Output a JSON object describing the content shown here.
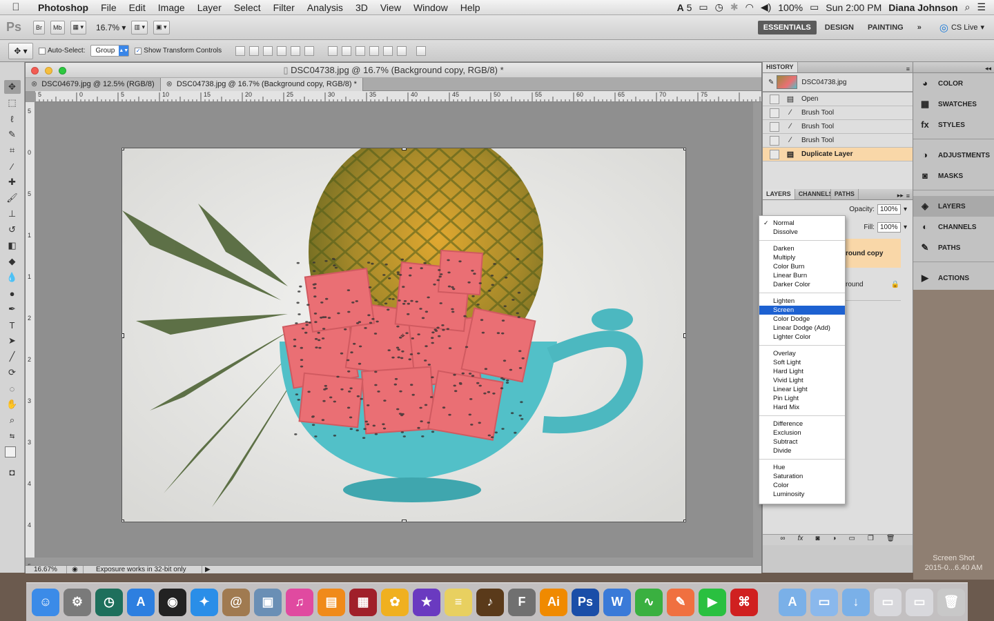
{
  "menubar": {
    "app": "Photoshop",
    "items": [
      "File",
      "Edit",
      "Image",
      "Layer",
      "Select",
      "Filter",
      "Analysis",
      "3D",
      "View",
      "Window",
      "Help"
    ],
    "status": {
      "adobe_count": "5",
      "battery": "100%",
      "clock": "Sun 2:00 PM",
      "user": "Diana Johnson"
    }
  },
  "appbar": {
    "logo": "Ps",
    "bridge": "Br",
    "minibridge": "Mb",
    "zoom": "16.7%",
    "workspaces": [
      "ESSENTIALS",
      "DESIGN",
      "PAINTING"
    ],
    "active_workspace": "ESSENTIALS",
    "more": "»",
    "cslive": "CS Live"
  },
  "options": {
    "auto_select_label": "Auto-Select:",
    "auto_select_value": "Group",
    "transform_label": "Show Transform Controls"
  },
  "document": {
    "title": "DSC04738.jpg @ 16.7% (Background copy, RGB/8) *",
    "tabs": [
      {
        "label": "DSC04679.jpg @ 12.5% (RGB/8)"
      },
      {
        "label": "DSC04738.jpg @ 16.7% (Background copy, RGB/8) *"
      }
    ],
    "ruler_labels": [
      "5",
      "0",
      "5",
      "10",
      "15",
      "20",
      "25",
      "30",
      "35",
      "40",
      "45",
      "50",
      "55",
      "60",
      "65",
      "70",
      "75"
    ],
    "ruler_v_labels": [
      "5",
      "0",
      "5",
      "1",
      "1",
      "2",
      "2",
      "3",
      "3",
      "4",
      "4",
      "5"
    ],
    "status_zoom": "16.67%",
    "status_text": "Exposure works in 32-bit only"
  },
  "history": {
    "title": "HISTORY",
    "snapshot": "DSC04738.jpg",
    "items": [
      {
        "label": "Open",
        "active": false
      },
      {
        "label": "Brush Tool",
        "active": false
      },
      {
        "label": "Brush Tool",
        "active": false
      },
      {
        "label": "Brush Tool",
        "active": false
      },
      {
        "label": "Duplicate Layer",
        "active": true
      }
    ]
  },
  "layers": {
    "tabs": [
      "LAYERS",
      "CHANNELS",
      "PATHS"
    ],
    "opacity_label": "Opacity:",
    "opacity": "100%",
    "fill_label": "Fill:",
    "fill": "100%",
    "layer_copy": "round copy",
    "layer_bg": "round"
  },
  "blend_modes": {
    "groups": [
      [
        "Normal",
        "Dissolve"
      ],
      [
        "Darken",
        "Multiply",
        "Color Burn",
        "Linear Burn",
        "Darker Color"
      ],
      [
        "Lighten",
        "Screen",
        "Color Dodge",
        "Linear Dodge (Add)",
        "Lighter Color"
      ],
      [
        "Overlay",
        "Soft Light",
        "Hard Light",
        "Vivid Light",
        "Linear Light",
        "Pin Light",
        "Hard Mix"
      ],
      [
        "Difference",
        "Exclusion",
        "Subtract",
        "Divide"
      ],
      [
        "Hue",
        "Saturation",
        "Color",
        "Luminosity"
      ]
    ],
    "checked": "Normal",
    "highlighted": "Screen"
  },
  "right_panels": {
    "group1": [
      "COLOR",
      "SWATCHES",
      "STYLES"
    ],
    "group2": [
      "ADJUSTMENTS",
      "MASKS"
    ],
    "group3": [
      "LAYERS",
      "CHANNELS",
      "PATHS"
    ],
    "group4": [
      "ACTIONS"
    ],
    "active": "LAYERS"
  },
  "desktop": {
    "screenshot_label": "Screen Shot",
    "screenshot_date": "2015-0...6.40 AM"
  },
  "dock": {
    "apps": [
      {
        "name": "finder",
        "color": "#3b8be8",
        "glyph": "☺"
      },
      {
        "name": "system-preferences",
        "color": "#7a7a7a",
        "glyph": "⚙"
      },
      {
        "name": "time-machine",
        "color": "#1e6f5c",
        "glyph": "◷"
      },
      {
        "name": "app-store",
        "color": "#2d7fe0",
        "glyph": "A"
      },
      {
        "name": "dashboard",
        "color": "#222",
        "glyph": "◉"
      },
      {
        "name": "safari",
        "color": "#2a8ee8",
        "glyph": "✦"
      },
      {
        "name": "contacts",
        "color": "#a07a50",
        "glyph": "@"
      },
      {
        "name": "preview",
        "color": "#6a8fb5",
        "glyph": "▣"
      },
      {
        "name": "itunes",
        "color": "#e04aa0",
        "glyph": "♫"
      },
      {
        "name": "ibooks",
        "color": "#f08a1a",
        "glyph": "▤"
      },
      {
        "name": "photo-booth",
        "color": "#a0202a",
        "glyph": "▦"
      },
      {
        "name": "photos",
        "color": "#f0b020",
        "glyph": "✿"
      },
      {
        "name": "imovie",
        "color": "#6a3ac0",
        "glyph": "★"
      },
      {
        "name": "stickies",
        "color": "#e8d060",
        "glyph": "≡"
      },
      {
        "name": "garageband",
        "color": "#5a3a1a",
        "glyph": "♪"
      },
      {
        "name": "fontlab",
        "color": "#707070",
        "glyph": "F"
      },
      {
        "name": "illustrator",
        "color": "#f08a00",
        "glyph": "Ai"
      },
      {
        "name": "photoshop",
        "color": "#1a4ea8",
        "glyph": "Ps"
      },
      {
        "name": "wacom",
        "color": "#3a7ad8",
        "glyph": "W"
      },
      {
        "name": "vectorize",
        "color": "#3ab040",
        "glyph": "∿"
      },
      {
        "name": "pencil-app",
        "color": "#f07040",
        "glyph": "✎"
      },
      {
        "name": "facetime",
        "color": "#2ac040",
        "glyph": "▶"
      },
      {
        "name": "acrobat",
        "color": "#d02020",
        "glyph": "⌘"
      },
      {
        "name": "applications-folder",
        "color": "#7ab0e8",
        "glyph": "A"
      },
      {
        "name": "documents-folder",
        "color": "#8ab8ec",
        "glyph": "▭"
      },
      {
        "name": "downloads-folder",
        "color": "#7ab0e8",
        "glyph": "↓"
      },
      {
        "name": "screenshot-stack",
        "color": "#d8d8dc",
        "glyph": "▭"
      },
      {
        "name": "screenshot-stack-2",
        "color": "#d8d8dc",
        "glyph": "▭"
      },
      {
        "name": "trash",
        "color": "#c8c8c8",
        "glyph": "🗑"
      }
    ]
  }
}
